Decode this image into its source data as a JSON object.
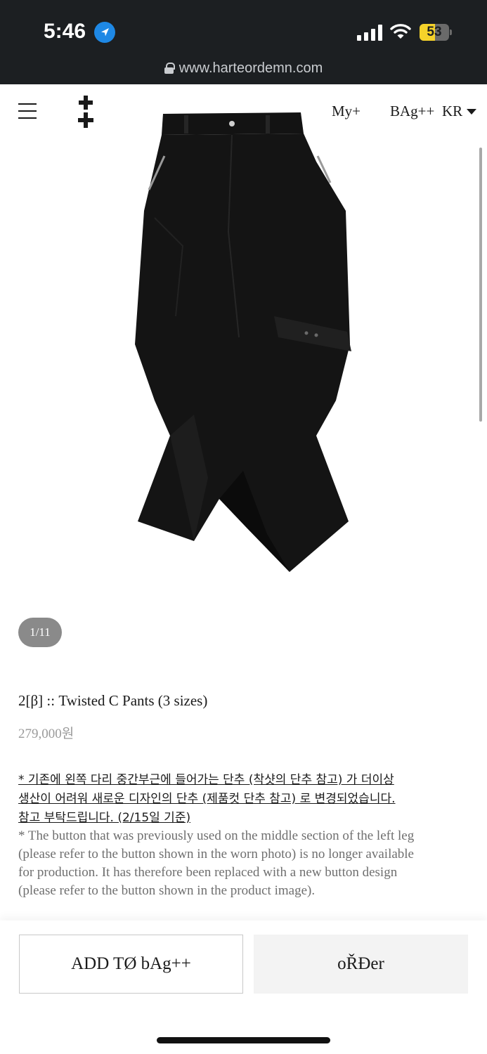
{
  "status_bar": {
    "time": "5:46",
    "battery_level": "53",
    "battery_fraction": 0.53,
    "battery_color": "#f5d22a",
    "icons": [
      "location-arrow-icon",
      "cell-signal-icon",
      "wifi-icon",
      "battery-icon"
    ]
  },
  "browser": {
    "url": "www.harteordemn.com",
    "icon": "lock-icon"
  },
  "header": {
    "menu_icon": "hamburger-menu-icon",
    "logo_icon": "double-cross-logo",
    "my_link": "My+",
    "bag_link": "BAg++",
    "language": "KR",
    "language_icon": "caret-down-icon"
  },
  "gallery": {
    "image": "black twisted cargo pants",
    "counter": "1/11",
    "current": 1,
    "total": 11
  },
  "product": {
    "title": "2[β] :: Twisted C Pants (3 sizes)",
    "price": "279,000원"
  },
  "notice": {
    "kr_lines": [
      "* 기존에 왼쪽 다리 중간부근에 들어가는 단추 (착샷의 단추 참고) 가 더이상",
      "생산이 어려워 새로운 디자인의 단추 (제품컷 단추 참고) 로 변경되었습니다.",
      "참고 부탁드립니다. (2/15일 기준)"
    ],
    "en_lines": [
      "* The button that was previously used on the middle section of the left leg",
      "(please refer to the button shown in the worn photo) is no longer available",
      "for production. It has therefore been replaced with a new button design",
      "(please refer to the button shown in the product image)."
    ]
  },
  "actions": {
    "add_to_bag": "ADD TØ bAg++",
    "order": "oŘĐer"
  }
}
